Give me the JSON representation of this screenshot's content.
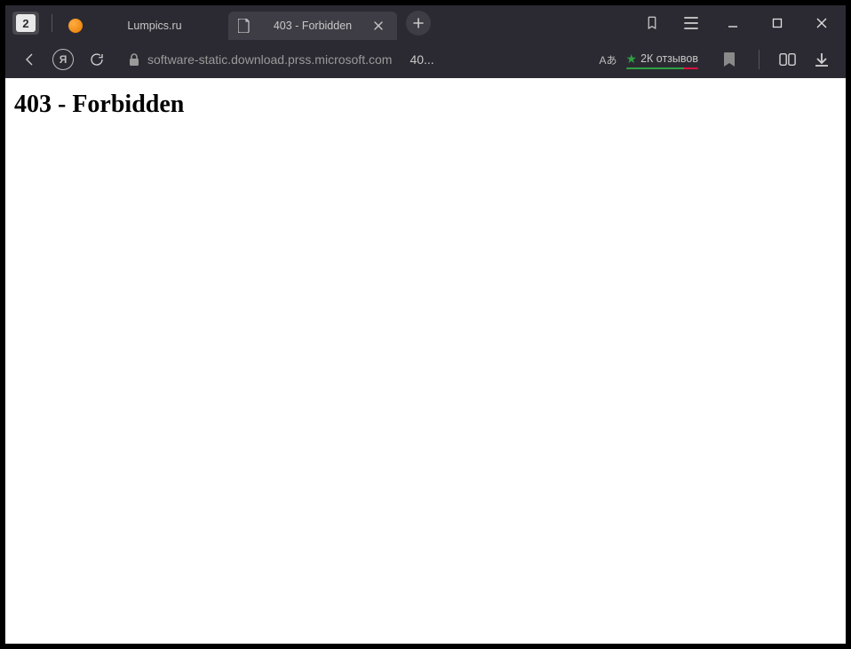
{
  "titlebar": {
    "tab_count_badge": "2",
    "tabs": [
      {
        "title": "Lumpics.ru",
        "active": false,
        "favicon": "orange-circle"
      },
      {
        "title": "403 - Forbidden",
        "active": true,
        "favicon": "document"
      }
    ],
    "new_tab_tooltip": "+"
  },
  "addressbar": {
    "host": "software-static.download.prss.microsoft.com",
    "title_truncated": "40...",
    "translate_label": "Aあ",
    "reviews_star": "★",
    "reviews_text": "2К отзывов"
  },
  "page": {
    "heading": "403 - Forbidden"
  }
}
